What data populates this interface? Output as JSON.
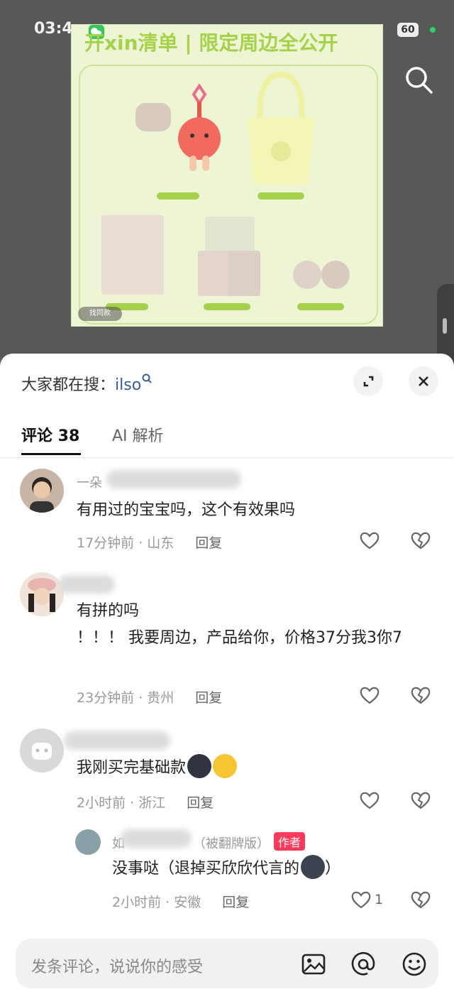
{
  "status": {
    "time": "03:4",
    "battery": "60"
  },
  "poster": {
    "title": "开xin清单 | 限定周边全公开",
    "find_same": "找同款"
  },
  "sheet": {
    "hot_search_prefix": "大家都在搜：",
    "hot_search_keyword": "ilso",
    "tabs": [
      {
        "label": "评论 38"
      },
      {
        "label": "AI 解析"
      }
    ]
  },
  "comments": [
    {
      "name": "一朵",
      "text": "有用过的宝宝吗，这个有效果吗",
      "time": "17分钟前 · 山东",
      "reply": "回复"
    },
    {
      "name": "",
      "text": "有拼的吗\n！！！ 我要周边，产品给你，价格37分我3你7",
      "time": "23分钟前 · 贵州",
      "reply": "回复"
    },
    {
      "name": "",
      "text": "我刚买完基础款",
      "time": "2小时前 · 浙江",
      "reply": "回复"
    },
    {
      "name": "如",
      "name_suffix": "（被翻牌版）",
      "badge": "作者",
      "text": "没事哒（退掉买欣欣代言的",
      "text_end": "）",
      "time": "2小时前 · 安徽",
      "reply": "回复",
      "likes": "1"
    }
  ],
  "input": {
    "placeholder": "发条评论，说说你的感受"
  },
  "colors": {
    "accent": "#ff3b5c",
    "poster_green": "#a6d14a",
    "link": "#3a5aa0"
  },
  "icons": [
    "search-icon",
    "expand-icon",
    "close-icon",
    "heart-icon",
    "broken-heart-icon",
    "image-icon",
    "at-icon",
    "emoji-icon",
    "wechat-icon"
  ]
}
